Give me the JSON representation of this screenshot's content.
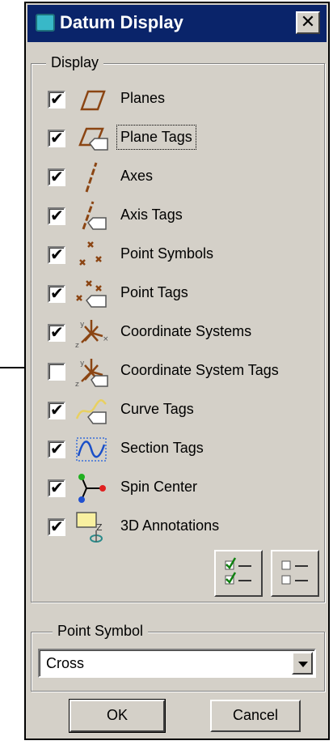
{
  "window": {
    "title": "Datum Display",
    "close_glyph": "✕"
  },
  "display_group": {
    "legend": "Display",
    "items": [
      {
        "label": "Planes",
        "checked": true,
        "icon": "plane-icon"
      },
      {
        "label": "Plane Tags",
        "checked": true,
        "icon": "plane-tag-icon",
        "focused": true
      },
      {
        "label": "Axes",
        "checked": true,
        "icon": "axis-icon"
      },
      {
        "label": "Axis Tags",
        "checked": true,
        "icon": "axis-tag-icon"
      },
      {
        "label": "Point Symbols",
        "checked": true,
        "icon": "point-symbol-icon"
      },
      {
        "label": "Point Tags",
        "checked": true,
        "icon": "point-tag-icon"
      },
      {
        "label": "Coordinate Systems",
        "checked": true,
        "icon": "coordinate-system-icon"
      },
      {
        "label": "Coordinate System Tags",
        "checked": false,
        "icon": "coordinate-system-tag-icon"
      },
      {
        "label": "Curve Tags",
        "checked": true,
        "icon": "curve-tag-icon"
      },
      {
        "label": "Section Tags",
        "checked": true,
        "icon": "section-tag-icon"
      },
      {
        "label": "Spin Center",
        "checked": true,
        "icon": "spin-center-icon"
      },
      {
        "label": "3D Annotations",
        "checked": true,
        "icon": "annotation-3d-icon"
      }
    ],
    "check_glyph": "✔"
  },
  "point_symbol_group": {
    "legend": "Point Symbol",
    "selected": "Cross"
  },
  "buttons": {
    "ok": "OK",
    "cancel": "Cancel"
  },
  "colors": {
    "title_bar": "#0a246a",
    "icon_brown": "#8b4513",
    "dialog_face": "#d4d0c8"
  }
}
